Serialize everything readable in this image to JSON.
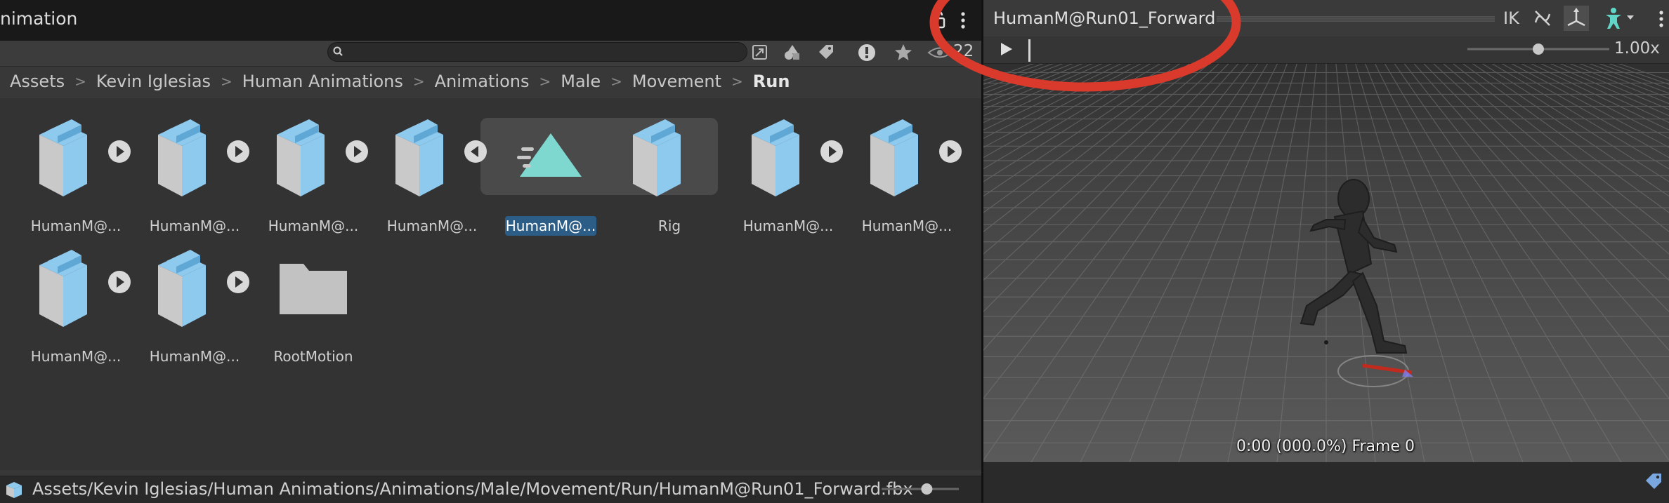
{
  "project_panel": {
    "title": "nimation",
    "search": {
      "placeholder": ""
    },
    "hidden_count": "22",
    "breadcrumb": [
      "Assets",
      "Kevin Iglesias",
      "Human Animations",
      "Animations",
      "Male",
      "Movement",
      "Run"
    ],
    "assets_row1": [
      {
        "label": "HumanM@...",
        "icon": "model-prefab-icon",
        "arrow": "right"
      },
      {
        "label": "HumanM@...",
        "icon": "model-prefab-icon",
        "arrow": "right"
      },
      {
        "label": "HumanM@...",
        "icon": "model-prefab-icon",
        "arrow": "right"
      },
      {
        "label": "HumanM@...",
        "icon": "model-prefab-icon",
        "arrow": "left"
      },
      {
        "label": "HumanM@...",
        "icon": "animation-clip-icon",
        "selected": true
      },
      {
        "label": "Rig",
        "icon": "model-prefab-icon"
      },
      {
        "label": "HumanM@...",
        "icon": "model-prefab-icon",
        "arrow": "right"
      },
      {
        "label": "HumanM@...",
        "icon": "model-prefab-icon",
        "arrow": "right"
      }
    ],
    "assets_row2": [
      {
        "label": "HumanM@...",
        "icon": "model-prefab-icon",
        "arrow": "right"
      },
      {
        "label": "HumanM@...",
        "icon": "model-prefab-icon",
        "arrow": "right"
      },
      {
        "label": "RootMotion",
        "icon": "folder-icon"
      }
    ],
    "status_path": "Assets/Kevin Iglesias/Human Animations/Animations/Male/Movement/Run/HumanM@Run01_Forward.fbx",
    "zoom_level": 0.6
  },
  "preview_panel": {
    "title": "HumanM@Run01_Forward",
    "ik_label": "IK",
    "speed": "1.00x",
    "speed_level": 0.5,
    "frame_readout": "0:00 (000.0%) Frame 0"
  },
  "colors": {
    "accent_selected": "#2c5d87",
    "annotation_red": "#d93a2b",
    "prefab_blue": "#8ec9ee",
    "clip_teal": "#7fd8d0"
  }
}
